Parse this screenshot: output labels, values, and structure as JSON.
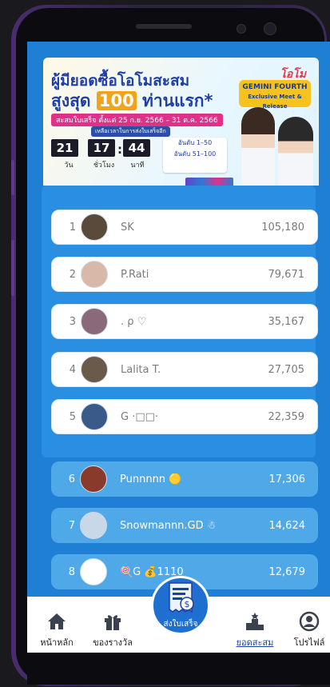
{
  "banner": {
    "title_line1": "ผู้มียอดซื้อโอโมสะสม",
    "title_line2_prefix": "สูงสุด",
    "title_highlight": "100",
    "title_line2_suffix": "ท่านแรก*",
    "date_range": "สะสมใบเสร็จ ตั้งแต่ 25 ก.ย. 2566 – 31 ต.ค. 2566",
    "note": "เหลือเวลาในการส่งใบเสร็จอีก",
    "timer": {
      "days": "21",
      "hours": "17",
      "minutes": "44",
      "days_label": "วัน",
      "hours_label": "ชั่วโมง",
      "minutes_label": "นาที"
    },
    "brand": "โอโม",
    "event_title": "GEMINI FOURTH",
    "event_subtitle": "Exclusive Meet & Release",
    "rank_tier1": "อันดับ 1–50",
    "rank_tier2": "อันดับ 51–100"
  },
  "leaderboard": [
    {
      "rank": "1",
      "name": "SK",
      "score": "105,180",
      "avatar_color": "#5a4a3a"
    },
    {
      "rank": "2",
      "name": "P.Rati",
      "score": "79,671",
      "avatar_color": "#d8b9a8"
    },
    {
      "rank": "3",
      "name": ". ρ ♡",
      "score": "35,167",
      "avatar_color": "#8a6a7a"
    },
    {
      "rank": "4",
      "name": "Lalita T.",
      "score": "27,705",
      "avatar_color": "#6a5a4a"
    },
    {
      "rank": "5",
      "name": "G ·□□·",
      "score": "22,359",
      "avatar_color": "#3a5a8a"
    },
    {
      "rank": "6",
      "name": "Punnnnn 🟡",
      "score": "17,306",
      "avatar_color": "#8a3a2a"
    },
    {
      "rank": "7",
      "name": "Snowmannn.GD ☃",
      "score": "14,624",
      "avatar_color": "#c8d8e8"
    },
    {
      "rank": "8",
      "name": "🍭G 💰1110",
      "score": "12,679",
      "avatar_color": "#ffffff"
    }
  ],
  "tabbar": {
    "home": "หน้าหลัก",
    "rewards": "ของรางวัล",
    "send_receipt": "ส่งใบเสร็จ",
    "total": "ยอดสะสม",
    "profile": "โปรไฟล์"
  },
  "colors": {
    "background": "#1f7fd4",
    "accent": "#1a3fa8",
    "row_top": "#ffffff",
    "row_low": "#4fa8e8"
  },
  "icons": [
    "home-icon",
    "gift-icon",
    "receipt-icon",
    "podium-icon",
    "user-icon"
  ]
}
